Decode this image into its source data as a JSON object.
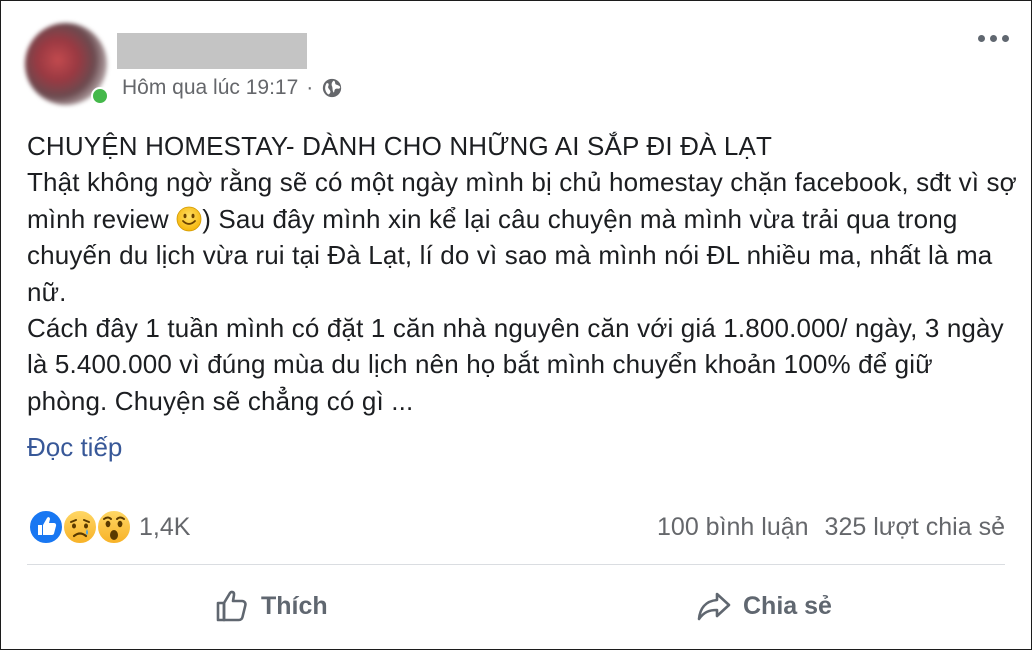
{
  "post": {
    "meta": {
      "timestamp": "Hôm qua lúc 19:17",
      "separator": "·",
      "privacy_icon": "globe-icon"
    },
    "title": "CHUYỆN HOMESTAY- DÀNH CHO NHỮNG AI SẮP ĐI ĐÀ LẠT",
    "para1_before_emoji": "Thật không ngờ rằng sẽ có một ngày mình bị chủ homestay chặn facebook, sđt vì sợ mình review ",
    "para1_after_emoji": ") Sau đây mình xin kể lại câu chuyện mà mình vừa trải qua trong chuyến du lịch vừa rui tại Đà Lạt, lí do vì sao mà mình nói ĐL nhiều ma, nhất là ma nữ.",
    "para2": "Cách đây 1 tuần mình có đặt 1 căn nhà nguyên căn với giá 1.800.000/ ngày, 3 ngày là 5.400.000 vì đúng mùa du lịch nên họ bắt mình chuyển khoản 100% để giữ phòng. Chuyện sẽ chẳng có gì ...",
    "read_more": "Đọc tiếp",
    "emoji_icon": "smiley-icon"
  },
  "reactions": {
    "icons": [
      "like-icon",
      "sad-icon",
      "wow-icon"
    ],
    "count": "1,4K",
    "comments": "100 bình luận",
    "shares": "325 lượt chia sẻ"
  },
  "actions": {
    "like_label": "Thích",
    "share_label": "Chia sẻ"
  },
  "colors": {
    "link": "#385898",
    "secondary_text": "#65676b",
    "like_blue": "#1877f2",
    "online_green": "#44b84a"
  }
}
